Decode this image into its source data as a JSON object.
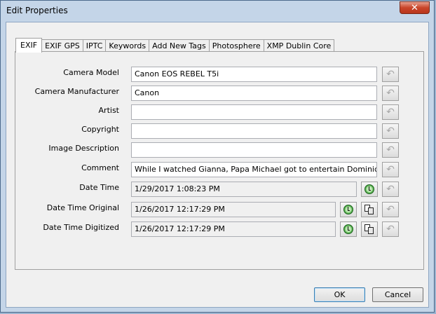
{
  "window": {
    "title": "Edit Properties",
    "close_label": "✕"
  },
  "tabs": [
    {
      "label": "EXIF",
      "active": true
    },
    {
      "label": "EXIF GPS"
    },
    {
      "label": "IPTC"
    },
    {
      "label": "Keywords"
    },
    {
      "label": "Add New Tags"
    },
    {
      "label": "Photosphere"
    },
    {
      "label": "XMP Dublin Core"
    }
  ],
  "fields": {
    "camera_model": {
      "label": "Camera Model",
      "value": "Canon EOS REBEL T5i"
    },
    "camera_manufacturer": {
      "label": "Camera Manufacturer",
      "value": "Canon"
    },
    "artist": {
      "label": "Artist",
      "value": ""
    },
    "copyright": {
      "label": "Copyright",
      "value": ""
    },
    "image_description": {
      "label": "Image Description",
      "value": ""
    },
    "comment": {
      "label": "Comment",
      "value": "While I watched Gianna, Papa Michael got to entertain Dominic. Or perhaps"
    },
    "date_time": {
      "label": "Date Time",
      "value": "1/29/2017 1:08:23 PM"
    },
    "date_time_original": {
      "label": "Date Time Original",
      "value": "1/26/2017 12:17:29 PM"
    },
    "date_time_digitized": {
      "label": "Date Time Digitized",
      "value": "1/26/2017 12:17:29 PM"
    }
  },
  "icons": {
    "undo": "undo-icon",
    "clock": "clock-icon",
    "copy": "copy-icon"
  },
  "buttons": {
    "ok": "OK",
    "cancel": "Cancel"
  }
}
